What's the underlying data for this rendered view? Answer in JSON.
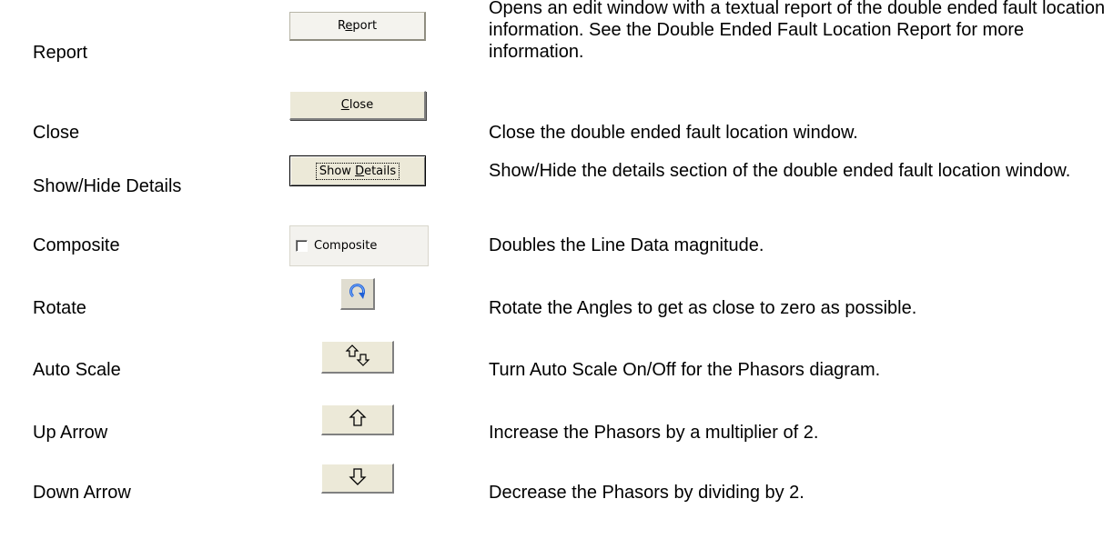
{
  "rows": [
    {
      "name": "Report",
      "control_label_pre": "R",
      "control_label_mnemonic": "e",
      "control_label_post": "port",
      "description": "Opens an edit window with a textual report of the double ended fault location information. See the Double Ended Fault Location Report for more information."
    },
    {
      "name": "Close",
      "control_label_mnemonic": "C",
      "control_label_post": "lose",
      "description": "Close the double ended fault location window."
    },
    {
      "name": "Show/Hide Details",
      "control_label_pre": "Show ",
      "control_label_mnemonic": "D",
      "control_label_post": "etails",
      "description": "Show/Hide the details section of the double ended fault location window."
    },
    {
      "name": "Composite",
      "control_label": "Composite",
      "control_checked": false,
      "description": "Doubles the Line Data magnitude."
    },
    {
      "name": "Rotate",
      "control_icon": "rotate-icon",
      "description": "Rotate the Angles to get as close to zero as possible."
    },
    {
      "name": "Auto Scale",
      "control_icon": "auto-scale-arrows-icon",
      "description": "Turn Auto Scale On/Off for the Phasors diagram."
    },
    {
      "name": "Up Arrow",
      "control_icon": "up-arrow-icon",
      "description": "Increase the Phasors by a multiplier of 2."
    },
    {
      "name": "Down Arrow",
      "control_icon": "down-arrow-icon",
      "description": "Decrease the Phasors by dividing by 2."
    }
  ]
}
